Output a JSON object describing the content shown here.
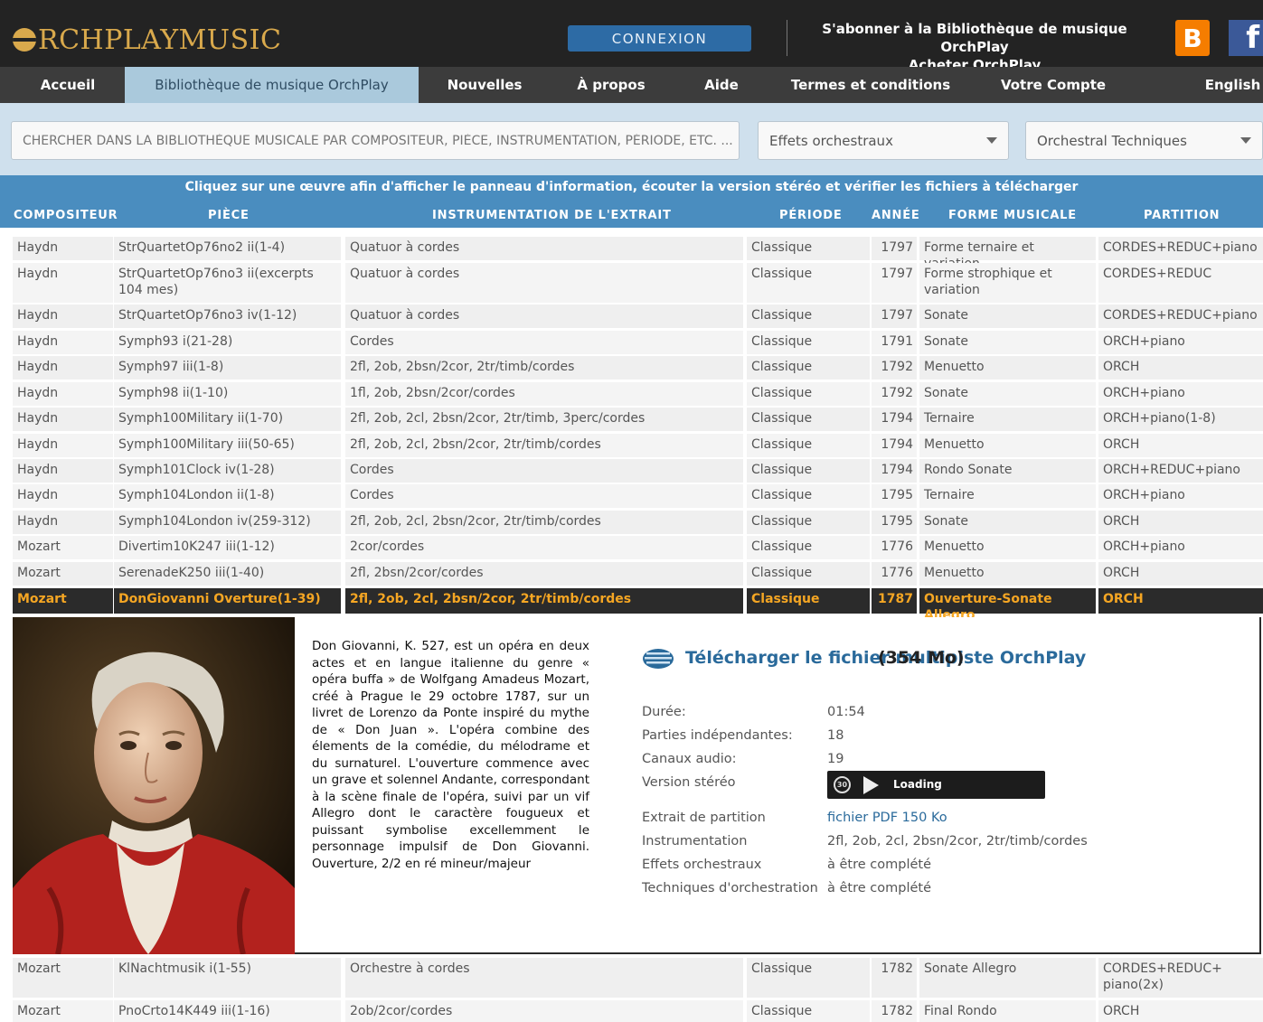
{
  "header": {
    "logo": "RCHPLAYMUSIC",
    "connexion": "CONNEXION",
    "subscribe": "S'abonner à la Bibliothèque de musique OrchPlay",
    "buy": "Acheter OrchPlay",
    "blogger_glyph": "B",
    "facebook_glyph": "f"
  },
  "nav": {
    "home": "Accueil",
    "library": "Bibliothèque de musique OrchPlay",
    "news": "Nouvelles",
    "about": "À propos",
    "help": "Aide",
    "terms": "Termes et conditions",
    "account": "Votre Compte",
    "language": "English"
  },
  "search": {
    "placeholder": "CHERCHER DANS LA BIBLIOTHÈQUE MUSICALE PAR COMPOSITEUR, PIÈCE, INSTRUMENTATION, PÉRIODE, ETC. ...",
    "effects_selected": "Effets orchestraux",
    "techniques_selected": "Orchestral Techniques"
  },
  "table": {
    "hint": "Cliquez sur une œuvre afin d'afficher le panneau d'information, écouter la version stéréo et vérifier les fichiers à télécharger",
    "headers": {
      "composer": "COMPOSITEUR",
      "piece": "PIÈCE",
      "instrumentation": "INSTRUMENTATION DE L'EXTRAIT",
      "period": "PÉRIODE",
      "year": "ANNÉE",
      "form": "FORME MUSICALE",
      "score": "PARTITION"
    },
    "rows": [
      {
        "composer": "Haydn",
        "piece": "StrQuartetOp76no2 ii(1-4)",
        "instrumentation": "Quatuor à cordes",
        "period": "Classique",
        "year": "1797",
        "form": "Forme ternaire et variation",
        "score": "CORDES+REDUC+piano"
      },
      {
        "composer": "Haydn",
        "piece": "StrQuartetOp76no3 ii(excerpts 104 mes)",
        "instrumentation": "Quatuor à cordes",
        "period": "Classique",
        "year": "1797",
        "form": "Forme strophique et variation",
        "score": "CORDES+REDUC"
      },
      {
        "composer": "Haydn",
        "piece": "StrQuartetOp76no3 iv(1-12)",
        "instrumentation": "Quatuor à cordes",
        "period": "Classique",
        "year": "1797",
        "form": "Sonate",
        "score": "CORDES+REDUC+piano"
      },
      {
        "composer": "Haydn",
        "piece": "Symph93 i(21-28)",
        "instrumentation": "Cordes",
        "period": "Classique",
        "year": "1791",
        "form": "Sonate",
        "score": "ORCH+piano"
      },
      {
        "composer": "Haydn",
        "piece": "Symph97 iii(1-8)",
        "instrumentation": "2fl, 2ob, 2bsn/2cor, 2tr/timb/cordes",
        "period": "Classique",
        "year": "1792",
        "form": "Menuetto",
        "score": "ORCH"
      },
      {
        "composer": "Haydn",
        "piece": "Symph98 ii(1-10)",
        "instrumentation": "1fl, 2ob, 2bsn/2cor/cordes",
        "period": "Classique",
        "year": "1792",
        "form": "Sonate",
        "score": "ORCH+piano"
      },
      {
        "composer": "Haydn",
        "piece": "Symph100Military ii(1-70)",
        "instrumentation": "2fl, 2ob, 2cl, 2bsn/2cor, 2tr/timb, 3perc/cordes",
        "period": "Classique",
        "year": "1794",
        "form": "Ternaire",
        "score": "ORCH+piano(1-8)"
      },
      {
        "composer": "Haydn",
        "piece": "Symph100Military iii(50-65)",
        "instrumentation": "2fl, 2ob, 2cl, 2bsn/2cor, 2tr/timb/cordes",
        "period": "Classique",
        "year": "1794",
        "form": "Menuetto",
        "score": "ORCH"
      },
      {
        "composer": "Haydn",
        "piece": "Symph101Clock iv(1-28)",
        "instrumentation": "Cordes",
        "period": "Classique",
        "year": "1794",
        "form": "Rondo Sonate",
        "score": "ORCH+REDUC+piano"
      },
      {
        "composer": "Haydn",
        "piece": "Symph104London ii(1-8)",
        "instrumentation": "Cordes",
        "period": "Classique",
        "year": "1795",
        "form": "Ternaire",
        "score": "ORCH+piano"
      },
      {
        "composer": "Haydn",
        "piece": "Symph104London iv(259-312)",
        "instrumentation": "2fl, 2ob, 2cl, 2bsn/2cor, 2tr/timb/cordes",
        "period": "Classique",
        "year": "1795",
        "form": "Sonate",
        "score": "ORCH"
      },
      {
        "composer": "Mozart",
        "piece": "Divertim10K247 iii(1-12)",
        "instrumentation": "2cor/cordes",
        "period": "Classique",
        "year": "1776",
        "form": "Menuetto",
        "score": "ORCH+piano"
      },
      {
        "composer": "Mozart",
        "piece": "SerenadeK250 iii(1-40)",
        "instrumentation": "2fl, 2bsn/2cor/cordes",
        "period": "Classique",
        "year": "1776",
        "form": "Menuetto",
        "score": "ORCH"
      },
      {
        "composer": "Mozart",
        "piece": "DonGiovanni Overture(1-39)",
        "instrumentation": "2fl, 2ob, 2cl, 2bsn/2cor, 2tr/timb/cordes",
        "period": "Classique",
        "year": "1787",
        "form": "Ouverture-Sonate Allegro",
        "score": "ORCH"
      },
      {
        "composer": "Mozart",
        "piece": "KlNachtmusik i(1-55)",
        "instrumentation": "Orchestre à cordes",
        "period": "Classique",
        "year": "1782",
        "form": "Sonate Allegro",
        "score": "CORDES+REDUC+ piano(2x)"
      },
      {
        "composer": "Mozart",
        "piece": "PnoCrto14K449 iii(1-16)",
        "instrumentation": "2ob/2cor/cordes",
        "period": "Classique",
        "year": "1782",
        "form": "Final Rondo",
        "score": "ORCH"
      }
    ]
  },
  "detail": {
    "description": "Don Giovanni, K. 527, est un opéra en deux actes et en langue italienne du genre « opéra buffa » de Wolfgang Amadeus Mozart, créé à Prague le 29 octobre 1787, sur un livret de Lorenzo da Ponte inspiré du mythe de « Don Juan ». L'opéra combine des élements de la comédie, du mélodrame et du surnaturel. L'ouverture commence avec un grave et solennel Andante, correspondant à la scène finale de l'opéra, suivi par un vif Allegro dont le caractère fougueux et puissant symbolise excellemment le personnage impulsif de Don Giovanni. Ouverture, 2/2 en ré mineur/majeur",
    "download_title": "Télécharger le fichier multipiste OrchPlay",
    "download_size": "(354 Mo)",
    "labels": {
      "duration": "Durée:",
      "parts": "Parties indépendantes:",
      "channels": "Canaux audio:",
      "stereo": "Version stéréo",
      "excerpt": "Extrait de partition",
      "instrumentation": "Instrumentation",
      "effects": "Effets orchestraux",
      "techniques": "Techniques d'orchestration"
    },
    "values": {
      "duration": "01:54",
      "parts": "18",
      "channels": "19",
      "player_skip": "30",
      "player_status": "Loading",
      "excerpt": "fichier PDF 150 Ko",
      "instrumentation": "2fl, 2ob, 2cl, 2bsn/2cor, 2tr/timb/cordes",
      "effects": "à être complété",
      "techniques": "à être complété"
    }
  },
  "colors": {
    "accent_blue": "#4a8dbf",
    "selected_text": "#f5a623",
    "link": "#2a6a9b"
  }
}
